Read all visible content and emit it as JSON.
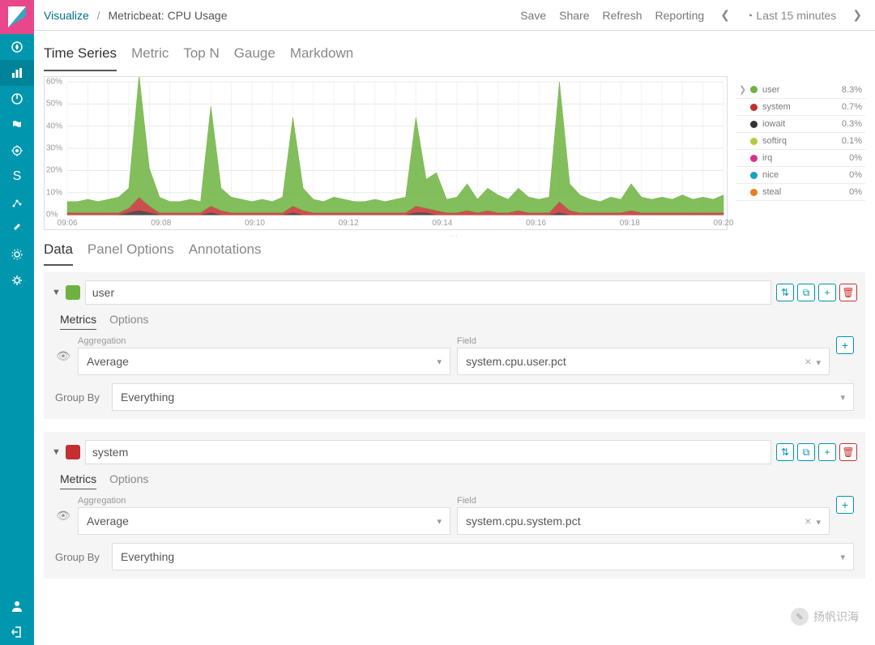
{
  "breadcrumb": {
    "root": "Visualize",
    "current": "Metricbeat: CPU Usage"
  },
  "topbar": {
    "save": "Save",
    "share": "Share",
    "refresh": "Refresh",
    "reporting": "Reporting",
    "timerange": "Last 15 minutes"
  },
  "vis_tabs": {
    "time_series": "Time Series",
    "metric": "Metric",
    "topn": "Top N",
    "gauge": "Gauge",
    "markdown": "Markdown"
  },
  "legend": [
    {
      "name": "user",
      "value": "8.3%",
      "color": "#6db33f"
    },
    {
      "name": "system",
      "value": "0.7%",
      "color": "#c23030"
    },
    {
      "name": "iowait",
      "value": "0.3%",
      "color": "#333333"
    },
    {
      "name": "softirq",
      "value": "0.1%",
      "color": "#b5c940"
    },
    {
      "name": "irq",
      "value": "0%",
      "color": "#d63384"
    },
    {
      "name": "nice",
      "value": "0%",
      "color": "#17a2b8"
    },
    {
      "name": "steal",
      "value": "0%",
      "color": "#e67e22"
    }
  ],
  "data_tabs": {
    "data": "Data",
    "panel_options": "Panel Options",
    "annotations": "Annotations"
  },
  "series": [
    {
      "color": "#6db33f",
      "label": "user",
      "subtabs": {
        "metrics": "Metrics",
        "options": "Options"
      },
      "agg_label": "Aggregation",
      "agg_value": "Average",
      "field_label": "Field",
      "field_value": "system.cpu.user.pct",
      "group_label": "Group By",
      "group_value": "Everything"
    },
    {
      "color": "#c23030",
      "label": "system",
      "subtabs": {
        "metrics": "Metrics",
        "options": "Options"
      },
      "agg_label": "Aggregation",
      "agg_value": "Average",
      "field_label": "Field",
      "field_value": "system.cpu.system.pct",
      "group_label": "Group By",
      "group_value": "Everything"
    }
  ],
  "watermark": "扬帆识海",
  "chart_data": {
    "type": "area",
    "xlabel": "",
    "ylabel": "",
    "ylim": [
      0,
      60
    ],
    "y_ticks": [
      "0%",
      "10%",
      "20%",
      "30%",
      "40%",
      "50%",
      "60%"
    ],
    "x_ticks": [
      "09:06",
      "09:08",
      "09:10",
      "09:12",
      "09:14",
      "09:16",
      "09:18",
      "09:20"
    ],
    "categories_note": "x-axis is time 09:06–09:21, sampled every ~10s; values in percent",
    "series": [
      {
        "name": "user",
        "color": "#6db33f",
        "values": [
          5,
          5,
          6,
          5,
          6,
          7,
          9,
          55,
          17,
          7,
          5,
          5,
          6,
          5,
          45,
          10,
          7,
          6,
          5,
          6,
          5,
          7,
          40,
          10,
          6,
          5,
          7,
          6,
          5,
          5,
          6,
          5,
          6,
          7,
          40,
          13,
          17,
          6,
          7,
          12,
          6,
          10,
          8,
          6,
          10,
          7,
          6,
          7,
          54,
          12,
          8,
          6,
          5,
          7,
          6,
          12,
          7,
          6,
          7,
          6,
          8,
          6,
          7,
          6,
          8
        ]
      },
      {
        "name": "system",
        "color": "#c23030",
        "values": [
          1,
          1,
          1,
          1,
          1,
          1,
          2,
          6,
          3,
          1,
          1,
          1,
          1,
          1,
          3,
          2,
          1,
          1,
          1,
          1,
          1,
          1,
          3,
          2,
          1,
          1,
          1,
          1,
          1,
          1,
          1,
          1,
          1,
          1,
          3,
          2,
          2,
          1,
          1,
          2,
          1,
          2,
          1,
          1,
          2,
          1,
          1,
          1,
          5,
          2,
          1,
          1,
          1,
          1,
          1,
          2,
          1,
          1,
          1,
          1,
          1,
          1,
          1,
          1,
          1
        ]
      },
      {
        "name": "iowait",
        "color": "#333333",
        "values": [
          0,
          0,
          0,
          0,
          0,
          0,
          1,
          2,
          1,
          0,
          0,
          0,
          0,
          0,
          1,
          0,
          0,
          0,
          0,
          0,
          0,
          0,
          1,
          0,
          0,
          0,
          0,
          0,
          0,
          0,
          0,
          0,
          0,
          0,
          1,
          1,
          0,
          0,
          0,
          0,
          0,
          0,
          0,
          0,
          0,
          0,
          0,
          0,
          1,
          0,
          0,
          0,
          0,
          0,
          0,
          0,
          0,
          0,
          0,
          0,
          0,
          0,
          0,
          0,
          0
        ]
      },
      {
        "name": "softirq",
        "color": "#b5c940",
        "values": [
          0,
          0,
          0,
          0,
          0,
          0,
          0,
          0,
          0,
          0,
          0,
          0,
          0,
          0,
          0,
          0,
          0,
          0,
          0,
          0,
          0,
          0,
          0,
          0,
          0,
          0,
          0,
          0,
          0,
          0,
          0,
          0,
          0,
          0,
          0,
          0,
          0,
          0,
          0,
          0,
          0,
          0,
          0,
          0,
          0,
          0,
          0,
          0,
          0,
          0,
          0,
          0,
          0,
          0,
          0,
          0,
          0,
          0,
          0,
          0,
          0,
          0,
          0,
          0,
          0
        ]
      },
      {
        "name": "irq",
        "color": "#d63384",
        "values": [
          0,
          0,
          0,
          0,
          0,
          0,
          0,
          0,
          0,
          0,
          0,
          0,
          0,
          0,
          0,
          0,
          0,
          0,
          0,
          0,
          0,
          0,
          0,
          0,
          0,
          0,
          0,
          0,
          0,
          0,
          0,
          0,
          0,
          0,
          0,
          0,
          0,
          0,
          0,
          0,
          0,
          0,
          0,
          0,
          0,
          0,
          0,
          0,
          0,
          0,
          0,
          0,
          0,
          0,
          0,
          0,
          0,
          0,
          0,
          0,
          0,
          0,
          0,
          0,
          0
        ]
      },
      {
        "name": "nice",
        "color": "#17a2b8",
        "values": [
          0,
          0,
          0,
          0,
          0,
          0,
          0,
          0,
          0,
          0,
          0,
          0,
          0,
          0,
          0,
          0,
          0,
          0,
          0,
          0,
          0,
          0,
          0,
          0,
          0,
          0,
          0,
          0,
          0,
          0,
          0,
          0,
          0,
          0,
          0,
          0,
          0,
          0,
          0,
          0,
          0,
          0,
          0,
          0,
          0,
          0,
          0,
          0,
          0,
          0,
          0,
          0,
          0,
          0,
          0,
          0,
          0,
          0,
          0,
          0,
          0,
          0,
          0,
          0,
          0
        ]
      },
      {
        "name": "steal",
        "color": "#e67e22",
        "values": [
          0,
          0,
          0,
          0,
          0,
          0,
          0,
          0,
          0,
          0,
          0,
          0,
          0,
          0,
          0,
          0,
          0,
          0,
          0,
          0,
          0,
          0,
          0,
          0,
          0,
          0,
          0,
          0,
          0,
          0,
          0,
          0,
          0,
          0,
          0,
          0,
          0,
          0,
          0,
          0,
          0,
          0,
          0,
          0,
          0,
          0,
          0,
          0,
          0,
          0,
          0,
          0,
          0,
          0,
          0,
          0,
          0,
          0,
          0,
          0,
          0,
          0,
          0,
          0,
          0
        ]
      }
    ]
  }
}
